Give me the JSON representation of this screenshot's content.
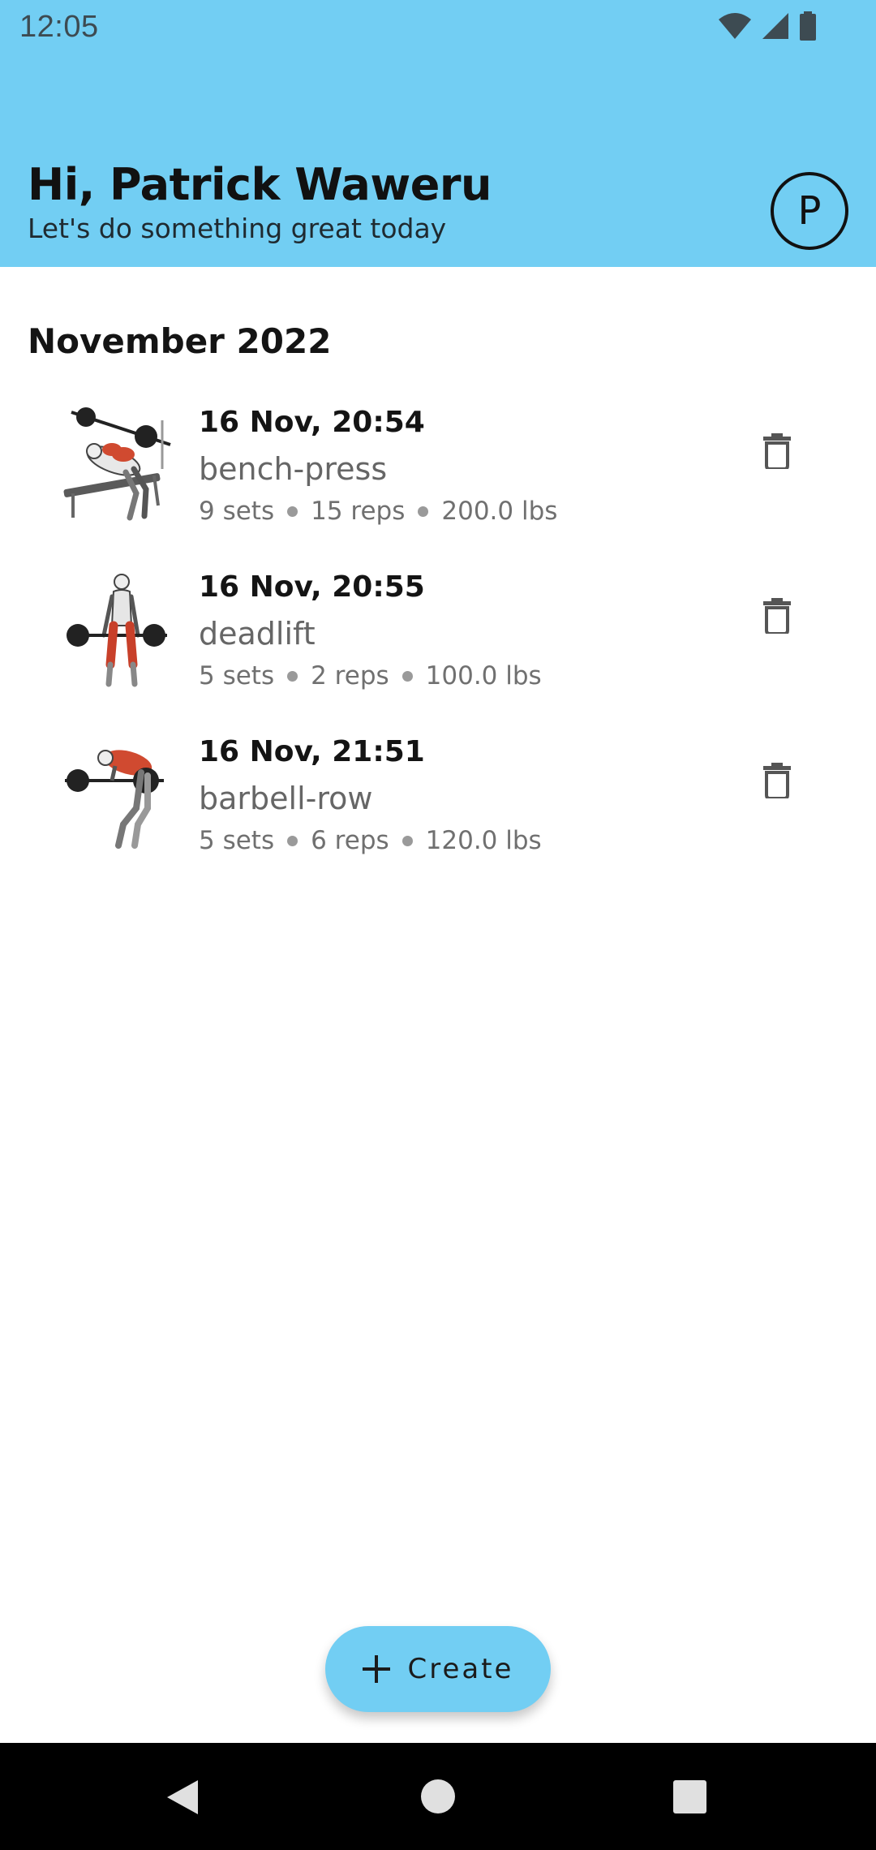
{
  "status_bar": {
    "time": "12:05",
    "icons": [
      "wifi-icon",
      "cellular-signal-icon",
      "battery-icon"
    ]
  },
  "header": {
    "greeting": "Hi, Patrick Waweru",
    "subtitle": "Let's do something great today",
    "avatar_initial": "P",
    "background_color": "#72cef3"
  },
  "section": {
    "title": "November 2022"
  },
  "workouts": [
    {
      "date": "16 Nov, 20:54",
      "exercise": "bench-press",
      "sets": "9 sets",
      "reps": "15 reps",
      "weight": "200.0 lbs",
      "icon": "bench-press-figure"
    },
    {
      "date": "16 Nov, 20:55",
      "exercise": "deadlift",
      "sets": "5 sets",
      "reps": "2 reps",
      "weight": "100.0 lbs",
      "icon": "deadlift-figure"
    },
    {
      "date": "16 Nov, 21:51",
      "exercise": "barbell-row",
      "sets": "5 sets",
      "reps": "6 reps",
      "weight": "120.0 lbs",
      "icon": "barbell-row-figure"
    }
  ],
  "fab": {
    "label": "Create",
    "icon": "plus-icon"
  },
  "nav_bar": {
    "icons": [
      "back-icon",
      "home-icon",
      "recents-icon"
    ]
  }
}
